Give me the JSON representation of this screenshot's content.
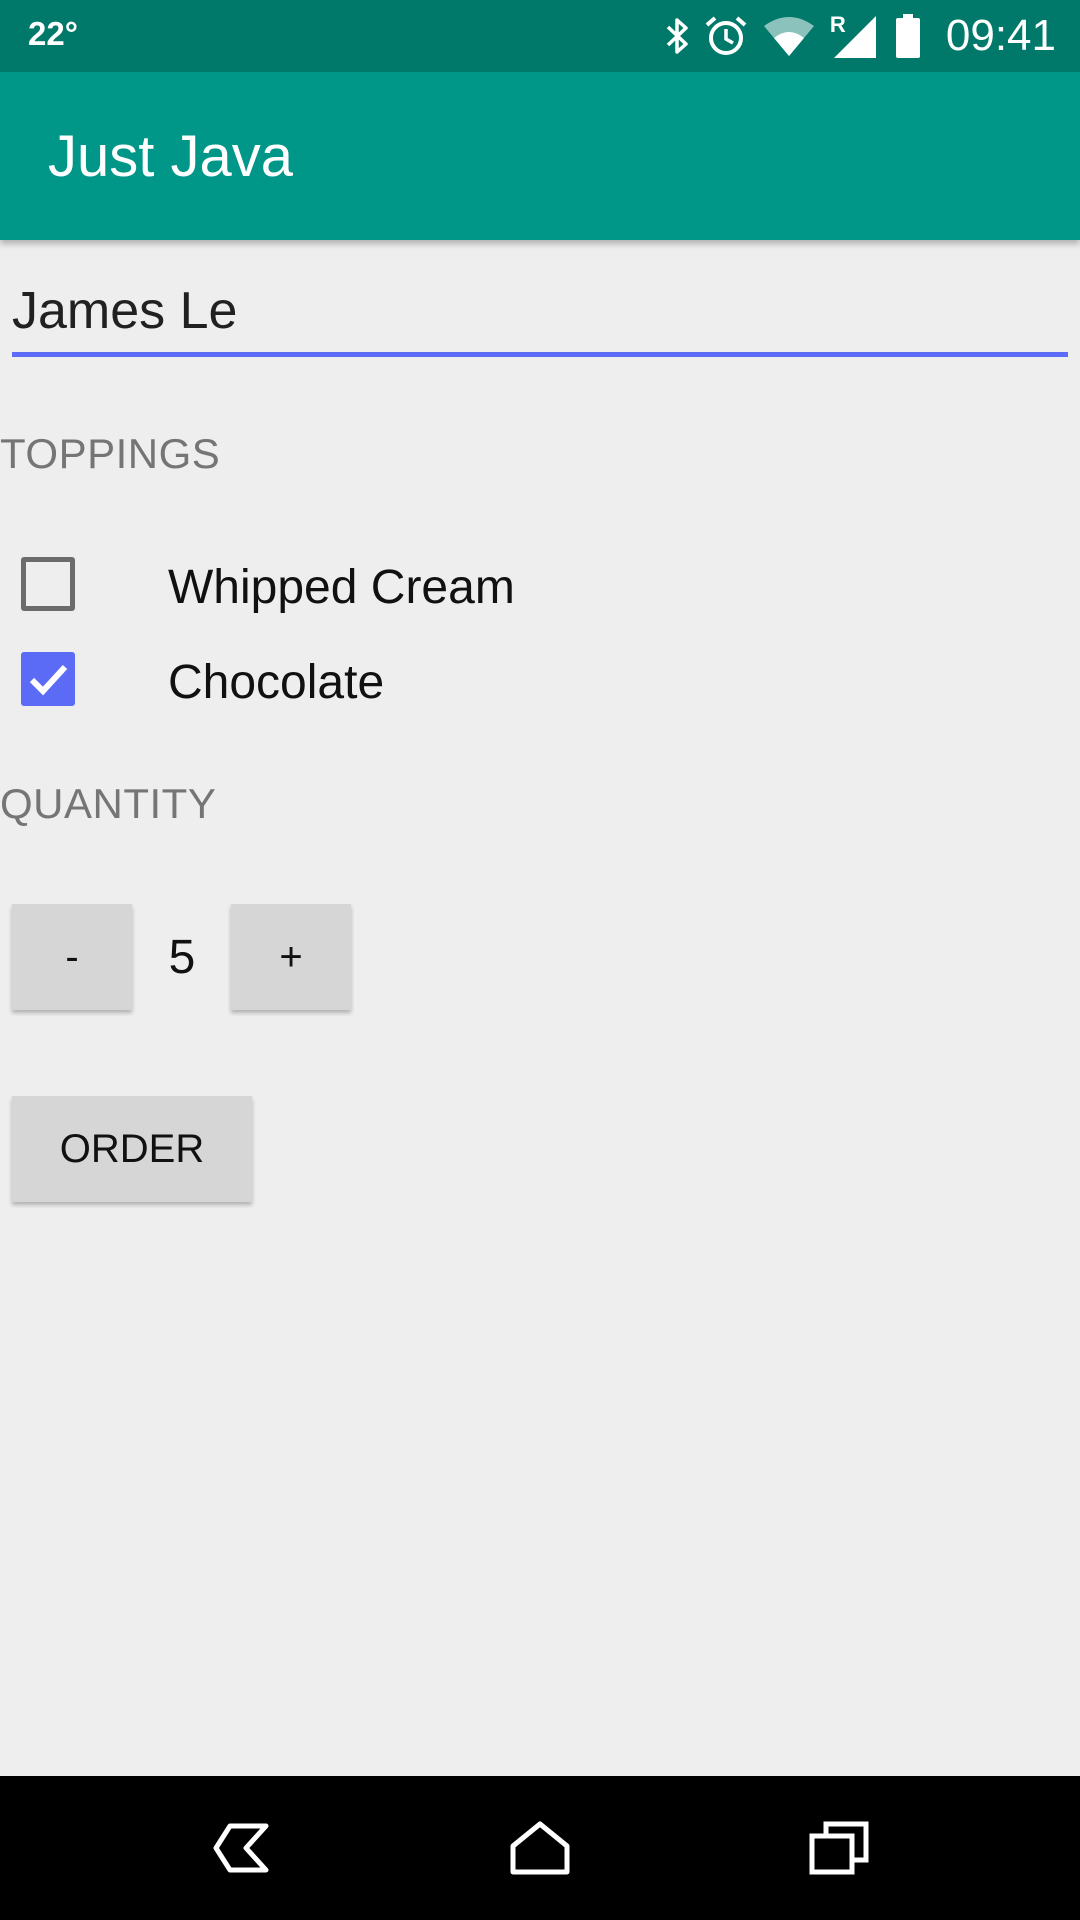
{
  "status_bar": {
    "temperature": "22°",
    "time": "09:41",
    "icons": [
      "bluetooth-icon",
      "alarm-icon",
      "wifi-icon",
      "signal-roaming-icon",
      "battery-icon"
    ],
    "roaming_indicator": "R"
  },
  "app_bar": {
    "title": "Just Java",
    "color": "#009688"
  },
  "form": {
    "name_value": "James Le",
    "accent_color": "#5c6bf5"
  },
  "toppings": {
    "label": "TOPPINGS",
    "items": [
      {
        "label": "Whipped Cream",
        "checked": false
      },
      {
        "label": "Chocolate",
        "checked": true
      }
    ]
  },
  "quantity": {
    "label": "QUANTITY",
    "decrement_label": "-",
    "value": "5",
    "increment_label": "+"
  },
  "order": {
    "label": "ORDER"
  },
  "nav_bar": {
    "icons": [
      "back-icon",
      "home-icon",
      "recents-icon"
    ]
  }
}
